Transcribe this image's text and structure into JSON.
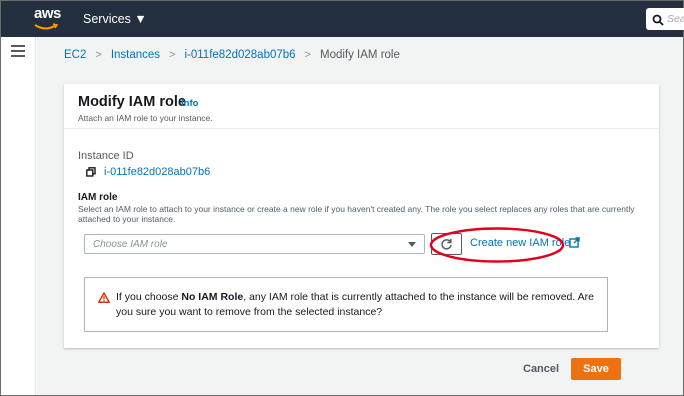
{
  "topbar": {
    "logo": "aws",
    "services_label": "Services ▼",
    "search_placeholder": "Sear"
  },
  "breadcrumb": {
    "items": [
      "EC2",
      "Instances",
      "i-011fe82d028ab07b6"
    ],
    "current": "Modify IAM role",
    "separator": ">"
  },
  "panel": {
    "title": "Modify IAM role",
    "info": "Info",
    "description": "Attach an IAM role to your instance."
  },
  "instance": {
    "label": "Instance ID",
    "value": "i-011fe82d028ab07b6"
  },
  "iam_role": {
    "label": "IAM role",
    "description": "Select an IAM role to attach to your instance or create a new role if you haven't created any. The role you select replaces any roles that are currently attached to your instance.",
    "select_placeholder": "Choose IAM role",
    "create_link": "Create new IAM role"
  },
  "alert": {
    "prefix": "If you choose ",
    "bold": "No IAM Role",
    "suffix": ", any IAM role that is currently attached to the instance will be removed. Are you sure you want to remove from the selected instance?"
  },
  "actions": {
    "cancel": "Cancel",
    "save": "Save"
  },
  "colors": {
    "topbar": "#232f3e",
    "link": "#0073bb",
    "primary": "#ec7211",
    "warning": "#d13212",
    "highlight": "#e0001b"
  }
}
